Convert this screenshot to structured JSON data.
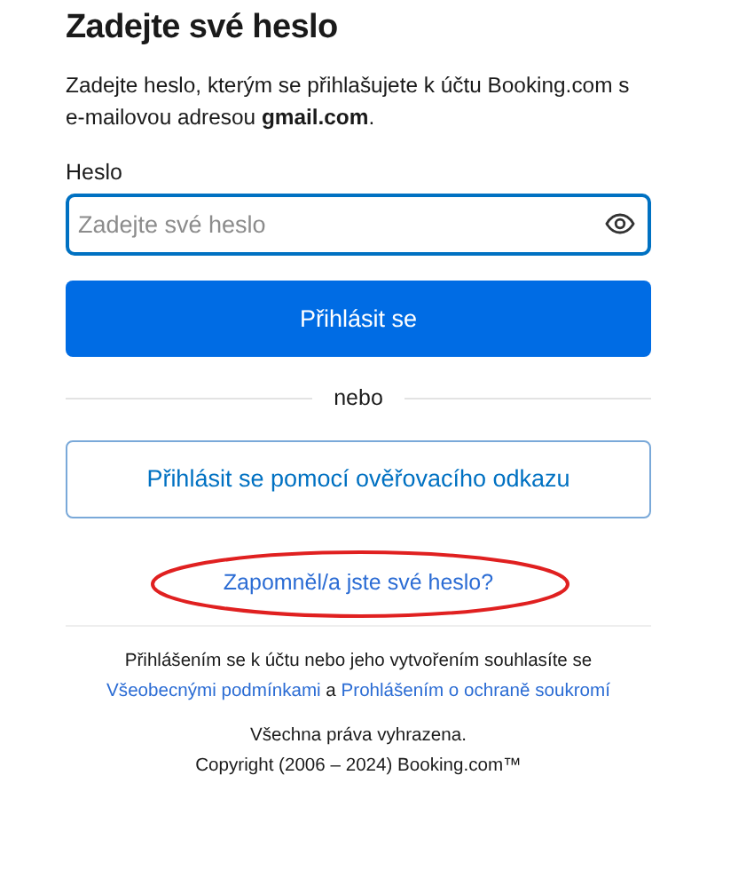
{
  "title": "Zadejte své heslo",
  "description": "Zadejte heslo, kterým se přihlašujete k účtu Booking.com s e-mailovou adresou **gmail.com**.",
  "password_field": {
    "label": "Heslo",
    "placeholder": "Zadejte své heslo"
  },
  "sign_in_button": "Přihlásit se",
  "divider_text": "nebo",
  "link_button": "Přihlásit se pomocí ověřovacího odkazu",
  "forgot_link": {
    "label": "Zapomněl/a jste své heslo?",
    "circled": true
  },
  "terms": {
    "intro": "Přihlášením se k účtu nebo jeho vytvořením souhlasíte se",
    "links": [
      "Všeobecnými podmínkami",
      "Prohlášením o ochraně soukromí"
    ],
    "joiner": "a"
  },
  "rights": "Všechna práva vyhrazena.",
  "copyright": "Copyright (2006 – 2024) Booking.com™"
}
